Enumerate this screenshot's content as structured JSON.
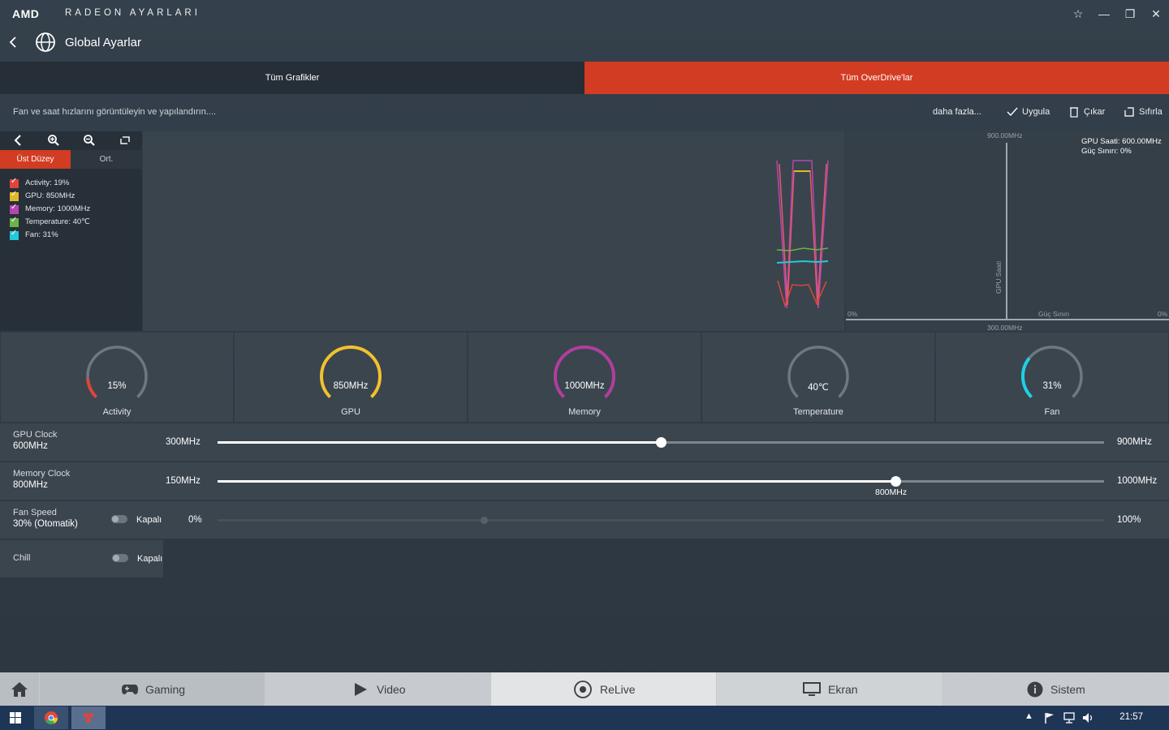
{
  "titlebar": {
    "brand": "AMD",
    "app_title": "RADEON AYARLARI"
  },
  "header": {
    "title": "Global Ayarlar"
  },
  "tabs": [
    {
      "label": "Tüm Grafikler",
      "active": false
    },
    {
      "label": "Tüm OverDrive'lar",
      "active": true
    }
  ],
  "info": {
    "text": "Fan ve saat hızlarını görüntüleyin ve yapılandırın....",
    "more": "daha fazla...",
    "apply": "Uygula",
    "discard": "Çıkar",
    "reset": "Sıfırla"
  },
  "graph_panel": {
    "mode_top": "Üst Düzey",
    "mode_avg": "Ort.",
    "legend": [
      {
        "label": "Activity: 19%",
        "color": "#e0443a"
      },
      {
        "label": "GPU: 850MHz",
        "color": "#e2b72a"
      },
      {
        "label": "Memory: 1000MHz",
        "color": "#b546b0"
      },
      {
        "label": "Temperature: 40℃",
        "color": "#6bb34a"
      },
      {
        "label": "Fan: 31%",
        "color": "#23c9d8"
      }
    ]
  },
  "od_plot": {
    "y_top": "900.00MHz",
    "y_bottom": "300.00MHz",
    "x_left": "0%",
    "x_right": "0%",
    "y_axis_label": "GPU Saati",
    "x_axis_label": "Güç Sınırı",
    "info_line1": "GPU Saati: 600.00MHz",
    "info_line2": "Güç Sınırı: 0%"
  },
  "gauges": [
    {
      "value": "15%",
      "label": "Activity",
      "fraction": 0.15,
      "color": "#e0443a"
    },
    {
      "value": "850MHz",
      "label": "GPU",
      "fraction": 1.0,
      "color": "#f2c12e"
    },
    {
      "value": "1000MHz",
      "label": "Memory",
      "fraction": 1.0,
      "color": "#b03e9c"
    },
    {
      "value": "40℃",
      "label": "Temperature",
      "fraction": 0.0,
      "color": "#8a929a"
    },
    {
      "value": "31%",
      "label": "Fan",
      "fraction": 0.31,
      "color": "#1fd0e6"
    }
  ],
  "gpu_clock": {
    "title": "GPU Clock",
    "value": "600MHz",
    "min": "300MHz",
    "max": "900MHz",
    "level": 0.5
  },
  "memory_clock": {
    "title": "Memory Clock",
    "value": "800MHz",
    "min": "150MHz",
    "max": "1000MHz",
    "level": 0.765,
    "thumb_label": "800MHz"
  },
  "fan_speed": {
    "title": "Fan Speed",
    "value": "30% (Otomatik)",
    "toggle": "Kapalı",
    "min": "0%",
    "max": "100%",
    "level": 0.3
  },
  "chill": {
    "title": "Chill",
    "toggle": "Kapalı"
  },
  "bottom_nav": [
    "Gaming",
    "Video",
    "ReLive",
    "Ekran",
    "Sistem"
  ],
  "taskbar": {
    "time": "21:57"
  }
}
